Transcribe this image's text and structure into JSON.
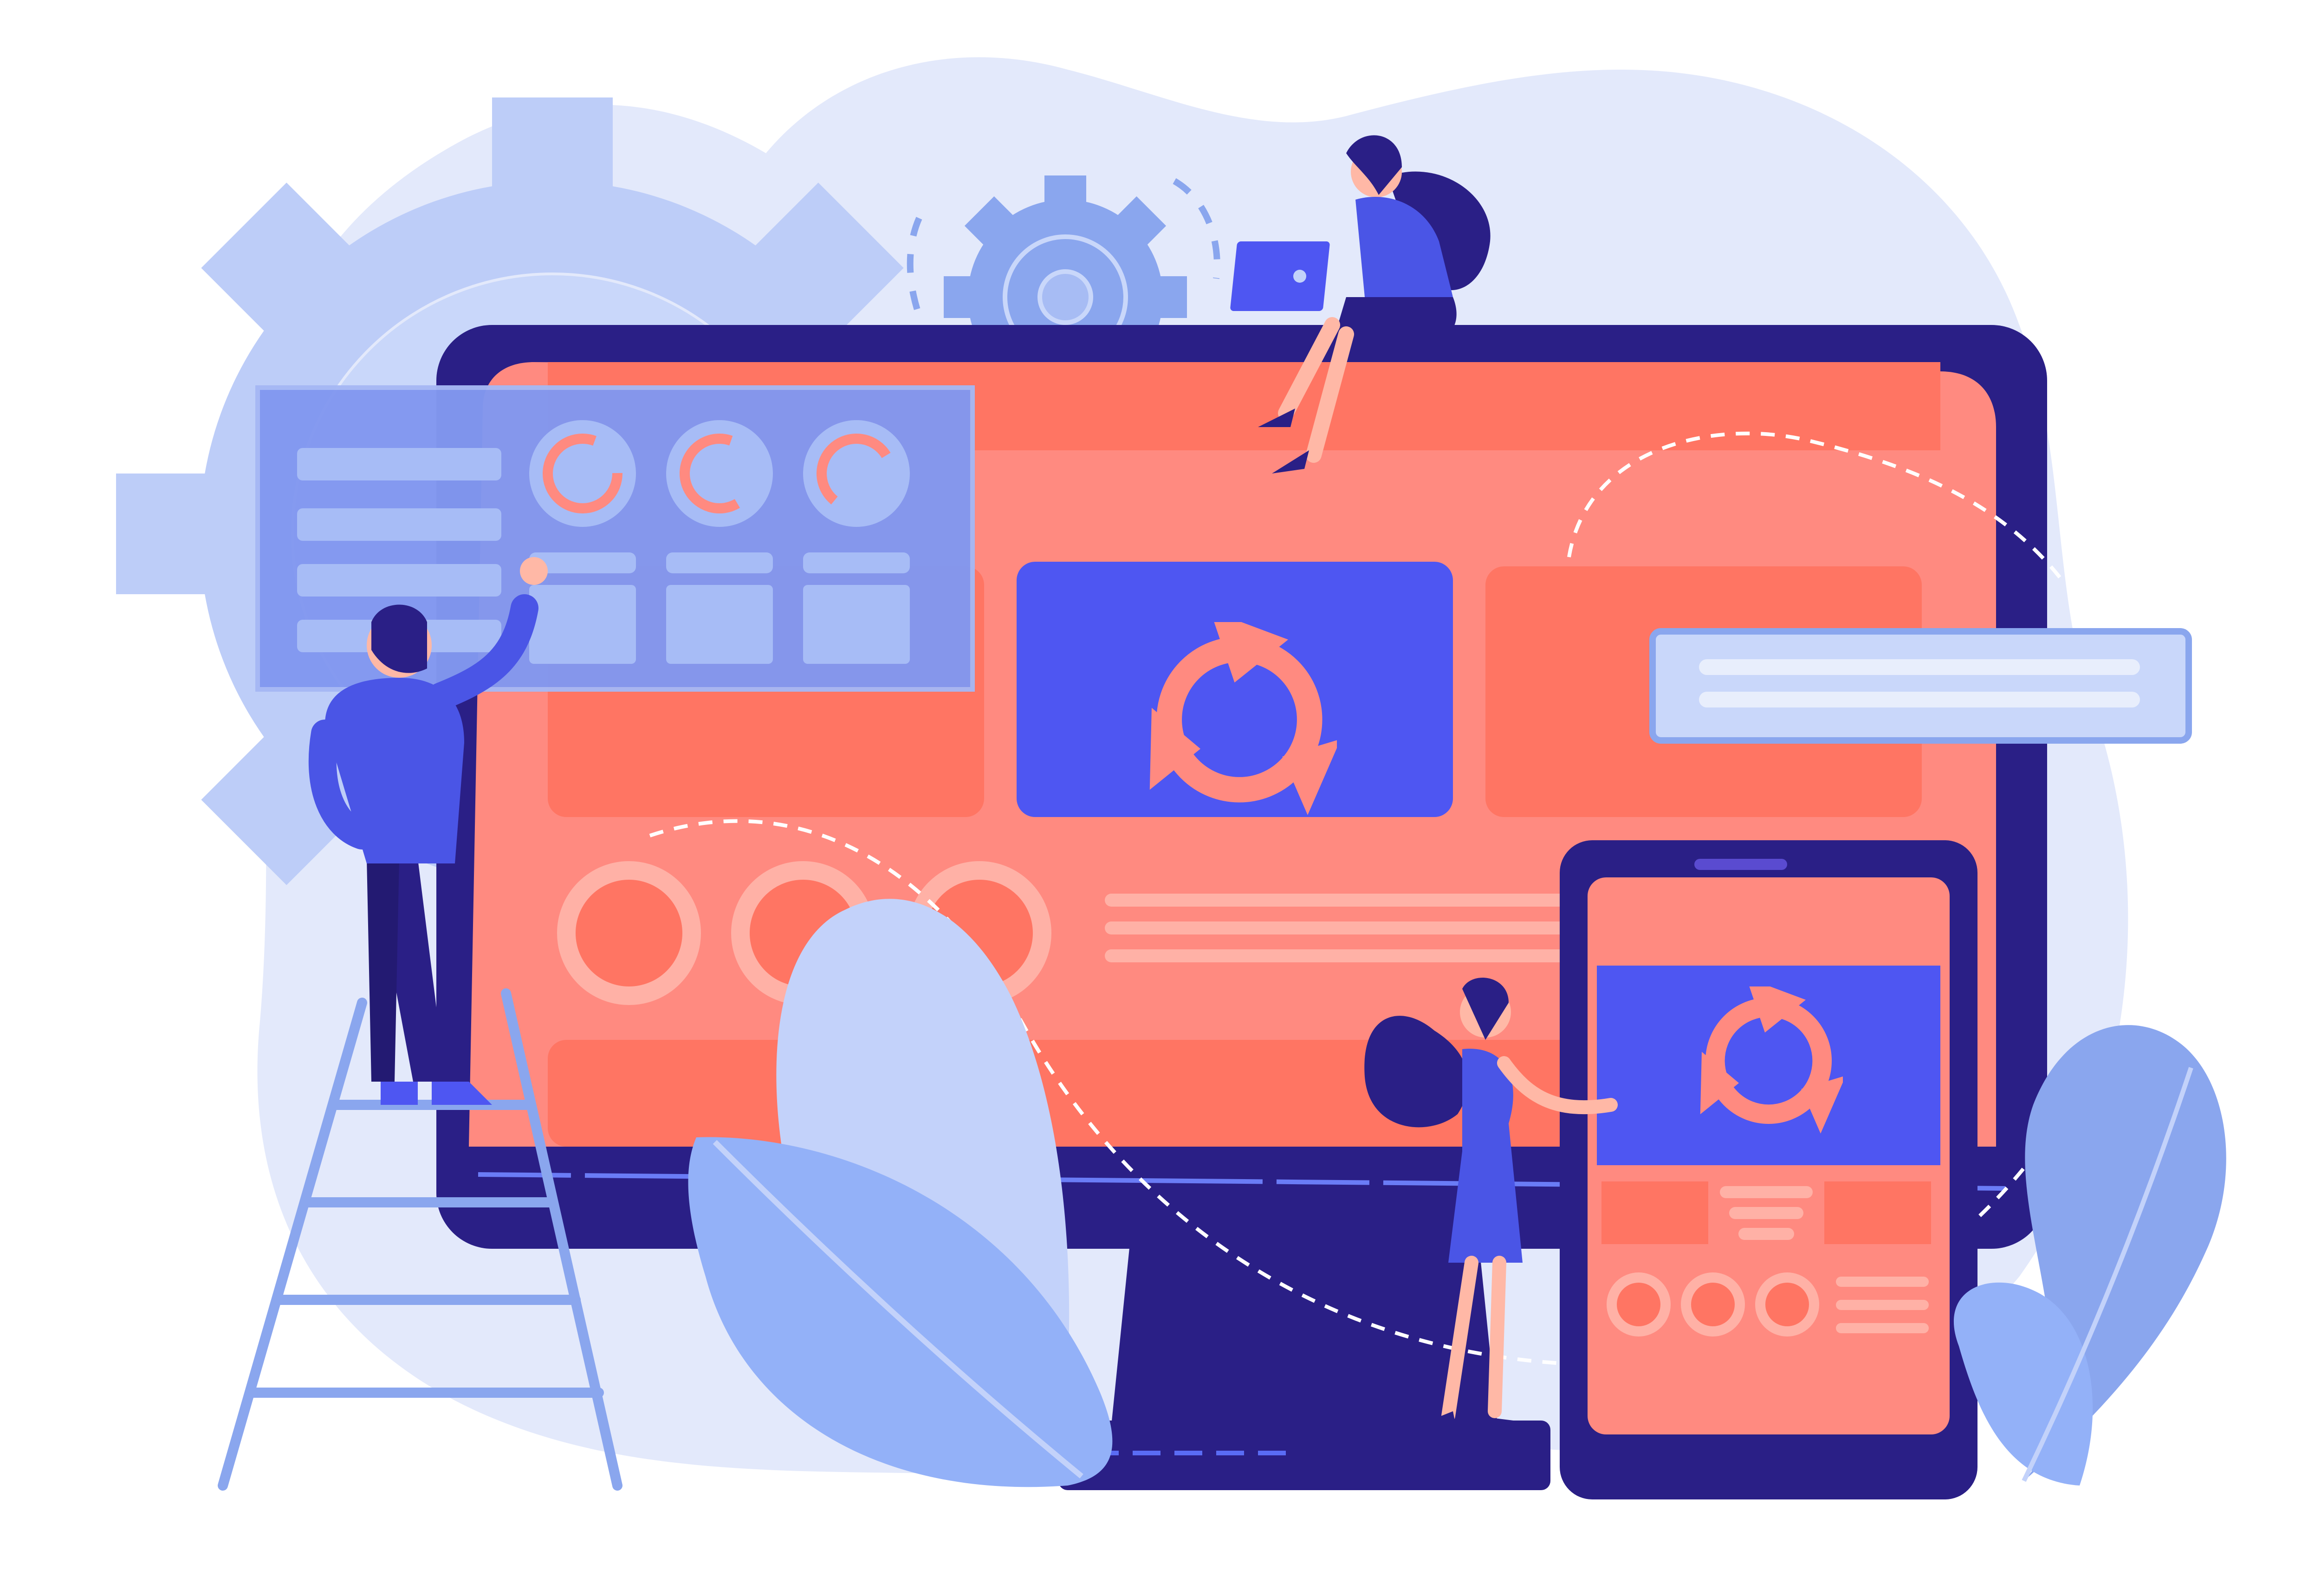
{
  "colors": {
    "background": "#ffffff",
    "blob_light": "#e3e9fb",
    "gear_light": "#bdcdf8",
    "gear_mid": "#8aa6ee",
    "monitor_frame": "#2a1f86",
    "monitor_screen": "#ff8a80",
    "screen_block": "#ff7563",
    "accent_blue": "#4e56f2",
    "panel_blue": "#8298f0",
    "leaf_light": "#c3d2fa",
    "leaf_mid": "#93b1f8",
    "skin": "#ffb8a6",
    "hair": "#2a1f86",
    "shirt": "#4a55e6"
  },
  "icons": {
    "sync": "sync-arrows-icon",
    "gear": "gear-icon",
    "progress": "progress-ring-icon"
  }
}
